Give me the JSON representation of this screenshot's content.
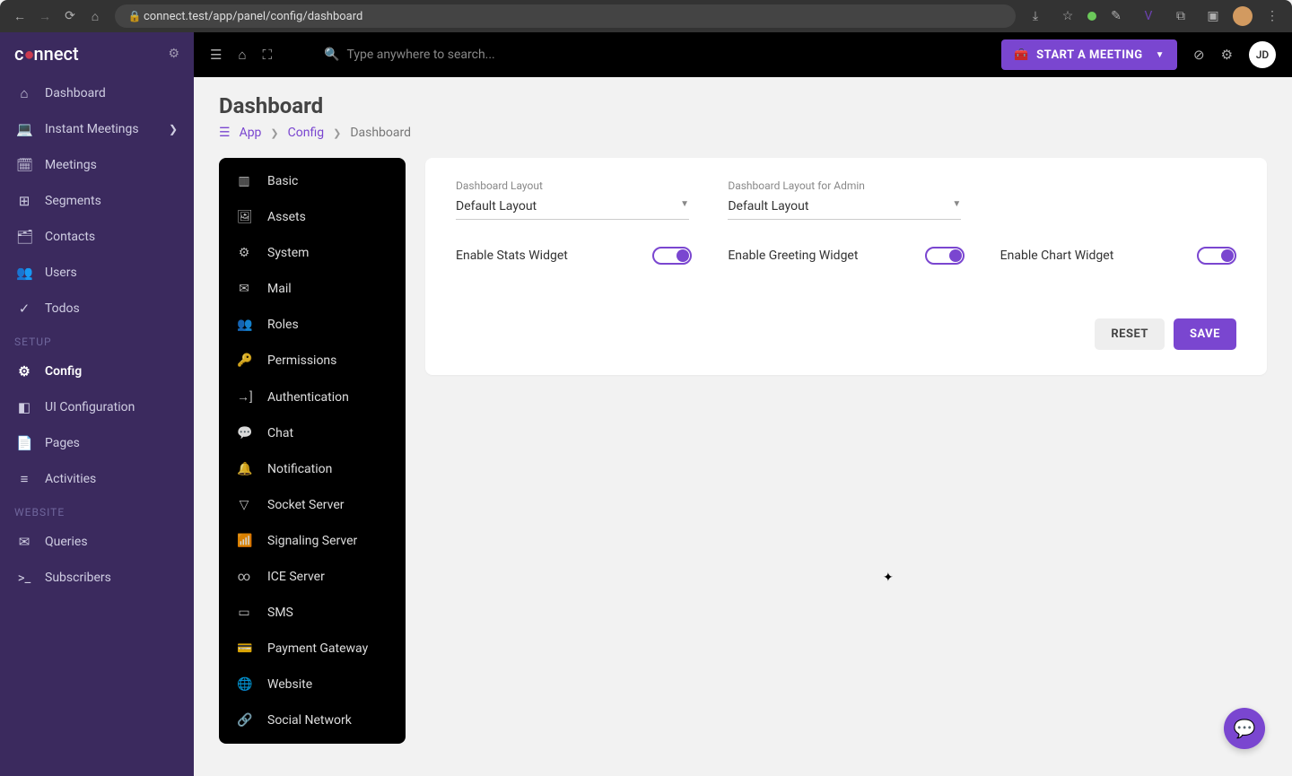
{
  "browser": {
    "url": "connect.test/app/panel/config/dashboard"
  },
  "brand": {
    "name_pre": "c",
    "name_o": "●",
    "name_post": "nnect"
  },
  "sidebar": {
    "main": [
      {
        "icon": "⌂",
        "label": "Dashboard"
      },
      {
        "icon": "💻",
        "label": "Instant Meetings",
        "hasChildren": true
      },
      {
        "icon": "🗓",
        "label": "Meetings"
      },
      {
        "icon": "⊞",
        "label": "Segments"
      },
      {
        "icon": "🗂",
        "label": "Contacts"
      },
      {
        "icon": "👥",
        "label": "Users"
      },
      {
        "icon": "✓",
        "label": "Todos"
      }
    ],
    "setup_label": "SETUP",
    "setup": [
      {
        "icon": "⚙",
        "label": "Config",
        "active": true
      },
      {
        "icon": "◧",
        "label": "UI Configuration"
      },
      {
        "icon": "📄",
        "label": "Pages"
      },
      {
        "icon": "≡",
        "label": "Activities"
      }
    ],
    "website_label": "WEBSITE",
    "website": [
      {
        "icon": "✉",
        "label": "Queries"
      },
      {
        "icon": ">_",
        "label": "Subscribers"
      }
    ]
  },
  "topbar": {
    "search_placeholder": "Type anywhere to search...",
    "start_label": "START A MEETING",
    "avatar_initials": "JD"
  },
  "page": {
    "title": "Dashboard",
    "breadcrumb": [
      "App",
      "Config",
      "Dashboard"
    ]
  },
  "configNav": [
    {
      "icon": "▥",
      "label": "Basic"
    },
    {
      "icon": "🖼",
      "label": "Assets"
    },
    {
      "icon": "⚙",
      "label": "System"
    },
    {
      "icon": "✉",
      "label": "Mail"
    },
    {
      "icon": "👥",
      "label": "Roles"
    },
    {
      "icon": "🔑",
      "label": "Permissions"
    },
    {
      "icon": "→]",
      "label": "Authentication"
    },
    {
      "icon": "💬",
      "label": "Chat"
    },
    {
      "icon": "🔔",
      "label": "Notification"
    },
    {
      "icon": "▽",
      "label": "Socket Server"
    },
    {
      "icon": "📶",
      "label": "Signaling Server"
    },
    {
      "icon": "∞",
      "label": "ICE Server"
    },
    {
      "icon": "▭",
      "label": "SMS"
    },
    {
      "icon": "💳",
      "label": "Payment Gateway"
    },
    {
      "icon": "🌐",
      "label": "Website"
    },
    {
      "icon": "🔗",
      "label": "Social Network"
    }
  ],
  "form": {
    "layout_label": "Dashboard Layout",
    "layout_value": "Default Layout",
    "admin_layout_label": "Dashboard Layout for Admin",
    "admin_layout_value": "Default Layout",
    "toggles": [
      {
        "label": "Enable Stats Widget",
        "on": true
      },
      {
        "label": "Enable Greeting Widget",
        "on": true
      },
      {
        "label": "Enable Chart Widget",
        "on": true
      }
    ],
    "reset": "RESET",
    "save": "SAVE"
  }
}
